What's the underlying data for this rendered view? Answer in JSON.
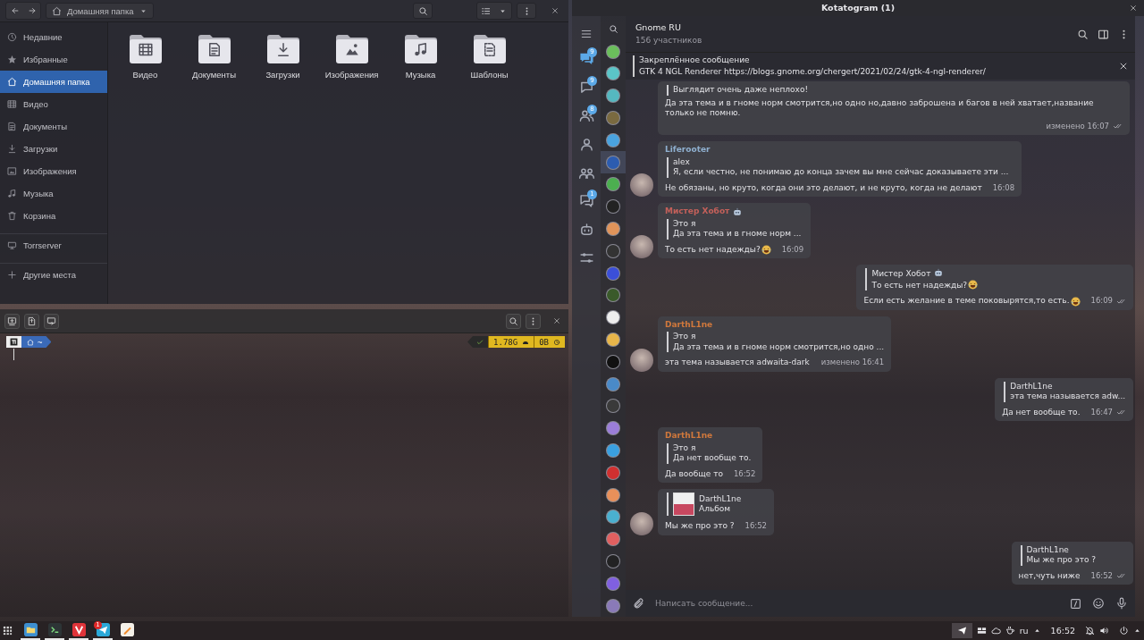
{
  "file_manager": {
    "path": "Домашняя папка",
    "sidebar": [
      {
        "kind": "recent",
        "label": "Недавние",
        "selected": false
      },
      {
        "kind": "starred",
        "label": "Избранные",
        "selected": false
      },
      {
        "kind": "home",
        "label": "Домашняя папка",
        "selected": true
      },
      {
        "kind": "videos",
        "label": "Видео",
        "selected": false
      },
      {
        "kind": "documents",
        "label": "Документы",
        "selected": false
      },
      {
        "kind": "downloads",
        "label": "Загрузки",
        "selected": false
      },
      {
        "kind": "pictures",
        "label": "Изображения",
        "selected": false
      },
      {
        "kind": "music",
        "label": "Музыка",
        "selected": false
      },
      {
        "kind": "trash",
        "label": "Корзина",
        "selected": false
      },
      {
        "kind": "server",
        "label": "Torrserver",
        "selected": false,
        "divider_before": true
      },
      {
        "kind": "other",
        "label": "Другие места",
        "selected": false,
        "divider_before": true
      }
    ],
    "folders": [
      {
        "kind": "videos",
        "label": "Видео"
      },
      {
        "kind": "documents",
        "label": "Документы"
      },
      {
        "kind": "downloads",
        "label": "Загрузки"
      },
      {
        "kind": "pictures",
        "label": "Изображения"
      },
      {
        "kind": "music",
        "label": "Музыка"
      },
      {
        "kind": "templates",
        "label": "Шаблоны"
      }
    ]
  },
  "terminal": {
    "prompt_path": "~",
    "status_ok": true,
    "memory": "1.78G",
    "size": "0B"
  },
  "telegram": {
    "title": "Kotatogram (1)",
    "folders": [
      {
        "kind": "all",
        "badge": "9",
        "selected": true
      },
      {
        "kind": "unread",
        "badge": "9",
        "selected": false
      },
      {
        "kind": "contacts",
        "badge": "8",
        "selected": false
      },
      {
        "kind": "personal",
        "selected": false
      },
      {
        "kind": "groups",
        "selected": false
      },
      {
        "kind": "channels",
        "badge": "1",
        "selected": false
      },
      {
        "kind": "bots",
        "selected": false
      },
      {
        "kind": "edit",
        "selected": false
      }
    ],
    "chats": [
      {
        "color": "#6bbf5c",
        "selected": false
      },
      {
        "color": "#5bc5c8",
        "selected": false
      },
      {
        "color": "#55b8c0",
        "selected": false
      },
      {
        "color": "#7a6a40",
        "selected": false
      },
      {
        "color": "#4aa3df",
        "selected": false
      },
      {
        "color": "#2c5cb0",
        "selected": true
      },
      {
        "color": "#4caf50",
        "selected": false
      },
      {
        "color": "#222222",
        "selected": false
      },
      {
        "color": "#e0945a",
        "selected": false
      },
      {
        "color": "#333333",
        "selected": false
      },
      {
        "color": "#3b4fd8",
        "selected": false
      },
      {
        "color": "#3a5a2a",
        "selected": false
      },
      {
        "color": "#eeeeee",
        "selected": false
      },
      {
        "color": "#e8b64a",
        "selected": false
      },
      {
        "color": "#111111",
        "selected": false
      },
      {
        "color": "#4a8ac8",
        "selected": false
      },
      {
        "color": "#3a3a3a",
        "selected": false
      },
      {
        "color": "#9b7ed8",
        "selected": false
      },
      {
        "color": "#3aa0e0",
        "selected": false
      },
      {
        "color": "#d03030",
        "selected": false
      },
      {
        "color": "#e8905a",
        "selected": false
      },
      {
        "color": "#4ab0d0",
        "selected": false
      },
      {
        "color": "#e06060",
        "selected": false
      },
      {
        "color": "#222223",
        "selected": false
      },
      {
        "color": "#8060e0",
        "selected": false
      },
      {
        "color": "#8a7ab8",
        "selected": false
      }
    ],
    "chat": {
      "title": "Gnome RU",
      "members": "156 участников"
    },
    "pinned": {
      "label": "Закреплённое сообщение",
      "text": "GTK 4 NGL Renderer https://blogs.gnome.org/chergert/2021/02/24/gtk-4-ngl-renderer/"
    },
    "messages": [
      {
        "outgoing": false,
        "avatar": false,
        "reply": {
          "text": "Выглядит очень даже неплохо!"
        },
        "text": "Да эта тема и в гноме норм смотрится,но одно но,давно заброшена и багов в ней хватает,название только не помню.",
        "time": "изменено 16:07",
        "read": true
      },
      {
        "outgoing": false,
        "avatar": true,
        "author": {
          "name": "Liferooter",
          "color": "#8fb0d0"
        },
        "reply": {
          "author": "alex",
          "text": "Я, если честно, не понимаю до конца зачем вы мне сейчас доказываете эти ..."
        },
        "text": "Не обязаны, но круто, когда они это делают, и не круто, когда не делают",
        "time": "16:08",
        "read": false
      },
      {
        "outgoing": false,
        "avatar": true,
        "author": {
          "name": "Мистер Хобот",
          "color": "#c4605a",
          "bot": true
        },
        "reply": {
          "author": "Это я",
          "text": "Да эта тема и в гноме норм ..."
        },
        "text": "То есть нет надежды?",
        "emoji": true,
        "time": "16:09",
        "read": false
      },
      {
        "outgoing": true,
        "avatar": false,
        "reply": {
          "author": "Мистер Хобот",
          "bot": true,
          "text": "То есть нет надежды?",
          "emoji": true
        },
        "text": "Если есть желание в теме поковырятся,то есть.",
        "emoji": true,
        "time": "16:09",
        "read": true
      },
      {
        "outgoing": false,
        "avatar": true,
        "author": {
          "name": "DarthL1ne",
          "color": "#d0783c"
        },
        "reply": {
          "author": "Это я",
          "text": "Да эта тема и в гноме норм смотрится,но одно ..."
        },
        "text": "эта тема называется adwaita-dark",
        "time": "изменено 16:41",
        "read": false
      },
      {
        "outgoing": true,
        "avatar": false,
        "reply": {
          "author": "DarthL1ne",
          "text": "эта тема называется adw..."
        },
        "text": "Да нет вообще то.",
        "time": "16:47",
        "read": true
      },
      {
        "outgoing": false,
        "avatar": false,
        "author": {
          "name": "DarthL1ne",
          "color": "#d0783c"
        },
        "reply": {
          "author": "Это я",
          "text": "Да нет вообще то."
        },
        "text": "Да вообще то",
        "time": "16:52",
        "read": false
      },
      {
        "outgoing": false,
        "avatar": true,
        "reply": {
          "author": "DarthL1ne",
          "text": "Альбом",
          "thumbnail": true
        },
        "text": "Мы же про это ?",
        "time": "16:52",
        "read": false
      },
      {
        "outgoing": true,
        "avatar": false,
        "reply": {
          "author": "DarthL1ne",
          "text": "Мы же про это ?"
        },
        "text": "нет,чуть ниже",
        "time": "16:52",
        "read": true
      }
    ],
    "composer": {
      "placeholder": "Написать сообщение..."
    }
  },
  "taskbar": {
    "apps": [
      {
        "kind": "files",
        "running": true
      },
      {
        "kind": "terminal",
        "running": true
      },
      {
        "kind": "browser",
        "running": true
      },
      {
        "kind": "messenger",
        "running": true,
        "badge": "1"
      },
      {
        "kind": "notes",
        "running": false
      }
    ],
    "language": "ru",
    "time": "16:52"
  }
}
